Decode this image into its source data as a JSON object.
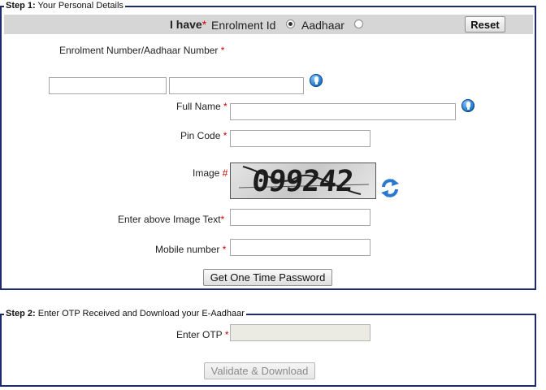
{
  "step1": {
    "legend_bold": "Step 1:",
    "legend_text": " Your Personal Details",
    "i_have": {
      "label": "I have",
      "required_mark": "*",
      "option_enrolment": "Enrolment Id",
      "option_aadhaar": "Aadhaar",
      "selected": "Enrolment Id"
    },
    "reset_label": "Reset",
    "enrolment_label": "Enrolment Number/Aadhaar Number",
    "enrolment_value_1": "",
    "enrolment_value_2": "",
    "full_name_label": "Full Name",
    "full_name_value": "",
    "pin_code_label": "Pin Code",
    "pin_code_value": "",
    "image_label": "Image",
    "image_mark": "#",
    "captcha_text": "099242",
    "captcha_input_label": "Enter above Image Text",
    "captcha_input_value": "",
    "mobile_label": "Mobile number",
    "mobile_value": "",
    "get_otp_label": "Get One Time Password",
    "required_mark": "*"
  },
  "step2": {
    "legend_bold": "Step 2:",
    "legend_text": " Enter OTP Received and Download your E-Aadhaar",
    "otp_label": "Enter OTP",
    "otp_value": "",
    "validate_label": "Validate & Download",
    "required_mark": "*"
  },
  "colors": {
    "frame_border": "#1d2a6b",
    "required": "#cc0000",
    "bar_background": "#d6d6d6",
    "icon_blue": "#1b6fc1"
  },
  "icons": {
    "help": "help-icon",
    "refresh": "refresh-icon"
  }
}
